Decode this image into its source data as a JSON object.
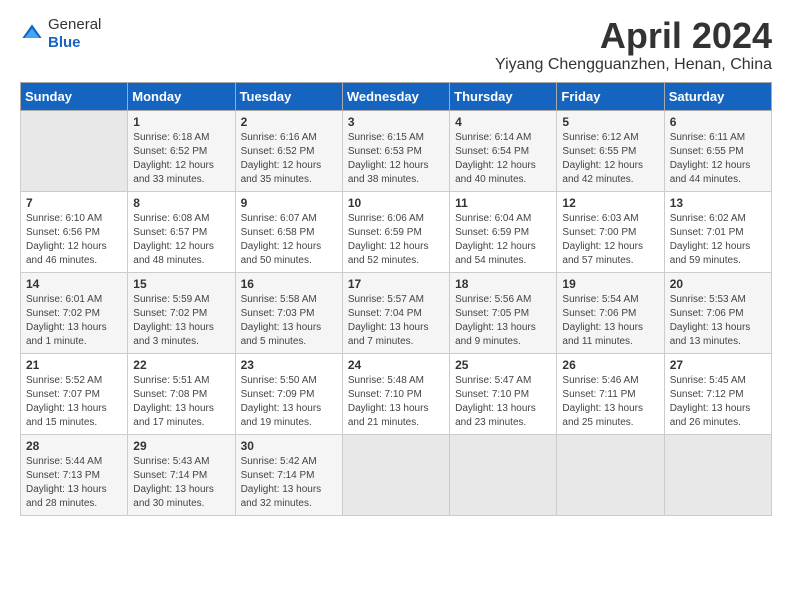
{
  "header": {
    "logo_general": "General",
    "logo_blue": "Blue",
    "month_title": "April 2024",
    "location": "Yiyang Chengguanzhen, Henan, China"
  },
  "weekdays": [
    "Sunday",
    "Monday",
    "Tuesday",
    "Wednesday",
    "Thursday",
    "Friday",
    "Saturday"
  ],
  "weeks": [
    [
      {
        "day": "",
        "content": ""
      },
      {
        "day": "1",
        "content": "Sunrise: 6:18 AM\nSunset: 6:52 PM\nDaylight: 12 hours\nand 33 minutes."
      },
      {
        "day": "2",
        "content": "Sunrise: 6:16 AM\nSunset: 6:52 PM\nDaylight: 12 hours\nand 35 minutes."
      },
      {
        "day": "3",
        "content": "Sunrise: 6:15 AM\nSunset: 6:53 PM\nDaylight: 12 hours\nand 38 minutes."
      },
      {
        "day": "4",
        "content": "Sunrise: 6:14 AM\nSunset: 6:54 PM\nDaylight: 12 hours\nand 40 minutes."
      },
      {
        "day": "5",
        "content": "Sunrise: 6:12 AM\nSunset: 6:55 PM\nDaylight: 12 hours\nand 42 minutes."
      },
      {
        "day": "6",
        "content": "Sunrise: 6:11 AM\nSunset: 6:55 PM\nDaylight: 12 hours\nand 44 minutes."
      }
    ],
    [
      {
        "day": "7",
        "content": "Sunrise: 6:10 AM\nSunset: 6:56 PM\nDaylight: 12 hours\nand 46 minutes."
      },
      {
        "day": "8",
        "content": "Sunrise: 6:08 AM\nSunset: 6:57 PM\nDaylight: 12 hours\nand 48 minutes."
      },
      {
        "day": "9",
        "content": "Sunrise: 6:07 AM\nSunset: 6:58 PM\nDaylight: 12 hours\nand 50 minutes."
      },
      {
        "day": "10",
        "content": "Sunrise: 6:06 AM\nSunset: 6:59 PM\nDaylight: 12 hours\nand 52 minutes."
      },
      {
        "day": "11",
        "content": "Sunrise: 6:04 AM\nSunset: 6:59 PM\nDaylight: 12 hours\nand 54 minutes."
      },
      {
        "day": "12",
        "content": "Sunrise: 6:03 AM\nSunset: 7:00 PM\nDaylight: 12 hours\nand 57 minutes."
      },
      {
        "day": "13",
        "content": "Sunrise: 6:02 AM\nSunset: 7:01 PM\nDaylight: 12 hours\nand 59 minutes."
      }
    ],
    [
      {
        "day": "14",
        "content": "Sunrise: 6:01 AM\nSunset: 7:02 PM\nDaylight: 13 hours\nand 1 minute."
      },
      {
        "day": "15",
        "content": "Sunrise: 5:59 AM\nSunset: 7:02 PM\nDaylight: 13 hours\nand 3 minutes."
      },
      {
        "day": "16",
        "content": "Sunrise: 5:58 AM\nSunset: 7:03 PM\nDaylight: 13 hours\nand 5 minutes."
      },
      {
        "day": "17",
        "content": "Sunrise: 5:57 AM\nSunset: 7:04 PM\nDaylight: 13 hours\nand 7 minutes."
      },
      {
        "day": "18",
        "content": "Sunrise: 5:56 AM\nSunset: 7:05 PM\nDaylight: 13 hours\nand 9 minutes."
      },
      {
        "day": "19",
        "content": "Sunrise: 5:54 AM\nSunset: 7:06 PM\nDaylight: 13 hours\nand 11 minutes."
      },
      {
        "day": "20",
        "content": "Sunrise: 5:53 AM\nSunset: 7:06 PM\nDaylight: 13 hours\nand 13 minutes."
      }
    ],
    [
      {
        "day": "21",
        "content": "Sunrise: 5:52 AM\nSunset: 7:07 PM\nDaylight: 13 hours\nand 15 minutes."
      },
      {
        "day": "22",
        "content": "Sunrise: 5:51 AM\nSunset: 7:08 PM\nDaylight: 13 hours\nand 17 minutes."
      },
      {
        "day": "23",
        "content": "Sunrise: 5:50 AM\nSunset: 7:09 PM\nDaylight: 13 hours\nand 19 minutes."
      },
      {
        "day": "24",
        "content": "Sunrise: 5:48 AM\nSunset: 7:10 PM\nDaylight: 13 hours\nand 21 minutes."
      },
      {
        "day": "25",
        "content": "Sunrise: 5:47 AM\nSunset: 7:10 PM\nDaylight: 13 hours\nand 23 minutes."
      },
      {
        "day": "26",
        "content": "Sunrise: 5:46 AM\nSunset: 7:11 PM\nDaylight: 13 hours\nand 25 minutes."
      },
      {
        "day": "27",
        "content": "Sunrise: 5:45 AM\nSunset: 7:12 PM\nDaylight: 13 hours\nand 26 minutes."
      }
    ],
    [
      {
        "day": "28",
        "content": "Sunrise: 5:44 AM\nSunset: 7:13 PM\nDaylight: 13 hours\nand 28 minutes."
      },
      {
        "day": "29",
        "content": "Sunrise: 5:43 AM\nSunset: 7:14 PM\nDaylight: 13 hours\nand 30 minutes."
      },
      {
        "day": "30",
        "content": "Sunrise: 5:42 AM\nSunset: 7:14 PM\nDaylight: 13 hours\nand 32 minutes."
      },
      {
        "day": "",
        "content": ""
      },
      {
        "day": "",
        "content": ""
      },
      {
        "day": "",
        "content": ""
      },
      {
        "day": "",
        "content": ""
      }
    ]
  ]
}
